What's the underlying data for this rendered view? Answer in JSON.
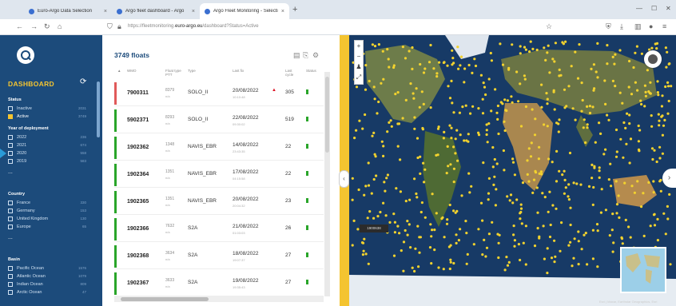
{
  "browser": {
    "tabs": [
      {
        "label": "Euro-Argo Data Selection",
        "active": false,
        "favicon_color": "#3b6fd0"
      },
      {
        "label": "Argo fleet dashboard - Argo",
        "active": false,
        "favicon_color": "#3b6fd0"
      },
      {
        "label": "Argo Fleet Monitoring - Selection",
        "active": true,
        "favicon_color": "#3b6fd0"
      }
    ],
    "new_tab": "+",
    "url_prefix": "https://fleetmonitoring.",
    "url_domain": "euro-argo.eu",
    "url_path": "/dashboard?Status=Active"
  },
  "sidebar": {
    "title": "DASHBOARD",
    "status": {
      "label": "Status",
      "items": [
        {
          "label": "Inactive",
          "count": "2031",
          "checked": false
        },
        {
          "label": "Active",
          "count": "3749",
          "checked": true
        }
      ]
    },
    "year": {
      "label": "Year of deployment",
      "items": [
        {
          "label": "2022",
          "count": "236",
          "checked": false
        },
        {
          "label": "2021",
          "count": "674",
          "checked": false
        },
        {
          "label": "2020",
          "count": "558",
          "checked": false
        },
        {
          "label": "2019",
          "count": "583",
          "checked": false
        }
      ],
      "more": "..."
    },
    "country": {
      "label": "Country",
      "items": [
        {
          "label": "France",
          "count": "330",
          "checked": false
        },
        {
          "label": "Germany",
          "count": "153",
          "checked": false
        },
        {
          "label": "United Kingdom",
          "count": "130",
          "checked": false
        },
        {
          "label": "Europe",
          "count": "65",
          "checked": false
        }
      ],
      "more": "..."
    },
    "basin": {
      "label": "Basin",
      "items": [
        {
          "label": "Pacific Ocean",
          "count": "1576",
          "checked": false
        },
        {
          "label": "Atlantic Ocean",
          "count": "1079",
          "checked": false
        },
        {
          "label": "Indian Ocean",
          "count": "809",
          "checked": false
        },
        {
          "label": "Arctic Ocean",
          "count": "47",
          "checked": false
        }
      ]
    }
  },
  "floats": {
    "title": "3749 floats",
    "columns": [
      "WMO",
      "Float type PTT",
      "Type",
      "Last fix",
      "Last cycle",
      "Status"
    ],
    "rows": [
      {
        "wmo": "7900311",
        "float_id": "8379",
        "sub": "n/a",
        "type": "SOLO_II",
        "date": "20/08/2022",
        "time": "10:10:48",
        "cycle": "305",
        "bar_color": "#e05a5a",
        "alert": true
      },
      {
        "wmo": "5902371",
        "float_id": "8293",
        "sub": "n/a",
        "type": "SOLO_II",
        "date": "22/08/2022",
        "time": "09:30:02",
        "cycle": "519",
        "bar_color": "#2aa52a",
        "alert": false
      },
      {
        "wmo": "1902362",
        "float_id": "1348",
        "sub": "n/a",
        "type": "NAVIS_EBR",
        "date": "14/08/2022",
        "time": "23:43:35",
        "cycle": "22",
        "bar_color": "#2aa52a",
        "alert": false
      },
      {
        "wmo": "1902364",
        "float_id": "1351",
        "sub": "n/a",
        "type": "NAVIS_EBR",
        "date": "17/08/2022",
        "time": "04:15:58",
        "cycle": "22",
        "bar_color": "#2aa52a",
        "alert": false
      },
      {
        "wmo": "1902365",
        "float_id": "1351",
        "sub": "n/a",
        "type": "NAVIS_EBR",
        "date": "20/08/2022",
        "time": "20:04:32",
        "cycle": "23",
        "bar_color": "#2aa52a",
        "alert": false
      },
      {
        "wmo": "1902366",
        "float_id": "7632",
        "sub": "n/a",
        "type": "S2A",
        "date": "21/08/2022",
        "time": "01:03:03",
        "cycle": "26",
        "bar_color": "#2aa52a",
        "alert": false
      },
      {
        "wmo": "1902368",
        "float_id": "3634",
        "sub": "n/a",
        "type": "S2A",
        "date": "18/08/2022",
        "time": "19:07:37",
        "cycle": "27",
        "bar_color": "#2aa52a",
        "alert": false
      },
      {
        "wmo": "1902367",
        "float_id": "3633",
        "sub": "n/a",
        "type": "S2A",
        "date": "19/08/2022",
        "time": "19:35:43",
        "cycle": "27",
        "bar_color": "#2aa52a",
        "alert": false
      }
    ]
  },
  "map": {
    "label": "1900638",
    "attribution": "Esri | Maxar, Earthstar Geographics, Esri",
    "zoom_in": "+",
    "zoom_out": "−"
  },
  "colors": {
    "sidebar_bg": "#1c4b7b",
    "accent_yellow": "#f4c430",
    "ocean": "#173a66",
    "float_dot": "#f2d22e"
  }
}
